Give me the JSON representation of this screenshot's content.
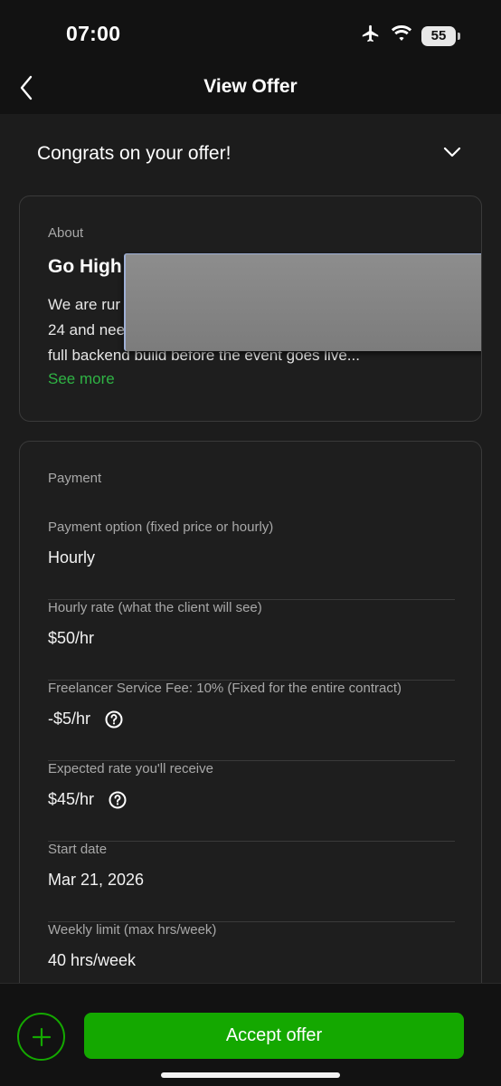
{
  "status_bar": {
    "time": "07:00",
    "battery": "55"
  },
  "header": {
    "title": "View Offer"
  },
  "congrats": {
    "title": "Congrats on your offer!"
  },
  "about": {
    "label": "About",
    "title": "Go High",
    "lines": [
      "We are rur",
      "24 and nee",
      "full backend build before the event goes live..."
    ],
    "see_more": "See more"
  },
  "payment": {
    "label": "Payment",
    "fields": [
      {
        "label": "Payment option (fixed price or hourly)",
        "value": "Hourly"
      },
      {
        "label": "Hourly rate (what the client will see)",
        "value": "$50/hr"
      },
      {
        "label": "Freelancer Service Fee: 10% (Fixed for the entire contract)",
        "value": "-$5/hr"
      },
      {
        "label": "Expected rate you'll receive",
        "value": "$45/hr"
      },
      {
        "label": "Start date",
        "value": "Mar 21, 2026"
      },
      {
        "label": "Weekly limit (max hrs/week)",
        "value": "40 hrs/week"
      }
    ]
  },
  "actions": {
    "accept_label": "Accept offer"
  },
  "colors": {
    "accent": "#14a800",
    "link": "#2fb344",
    "background": "#1c1c1c"
  },
  "icons": [
    "airplane-icon",
    "wifi-icon",
    "battery-icon",
    "back-chevron-icon",
    "chevron-down-icon",
    "help-icon",
    "plus-icon"
  ]
}
